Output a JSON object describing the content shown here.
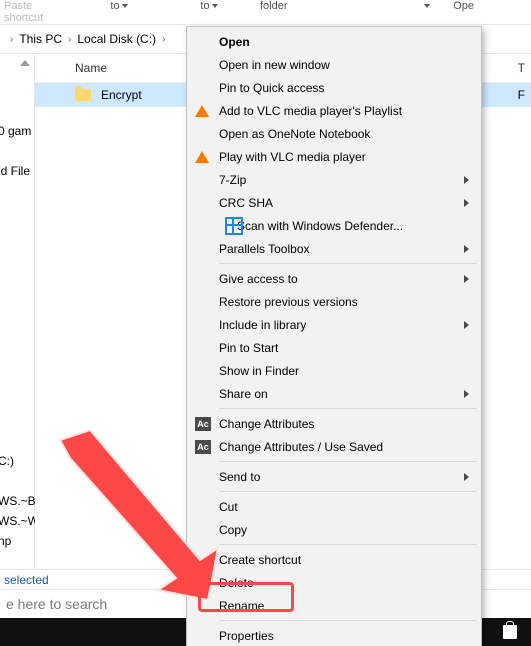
{
  "ribbon": {
    "paste": "Paste shortcut",
    "to1": "to",
    "to2": "to",
    "folder": "folder",
    "open": "Ope"
  },
  "breadcrumb": {
    "pc": "This PC",
    "disk": "Local Disk (C:)"
  },
  "list": {
    "header_name": "Name",
    "header_type": "T",
    "item0": "Encrypt",
    "item0_type_initial": "F"
  },
  "nav_ghosts": {
    "g1": "0 gam",
    "g2": "id File",
    "g3": "C:)",
    "g4": "WS.~B",
    "g5": "WS.~WS",
    "g6": "np"
  },
  "status": "selected",
  "search_placeholder": "e here to search",
  "ctx": {
    "open": "Open",
    "newwin": "Open in new window",
    "pinqa": "Pin to Quick access",
    "addvlc": "Add to VLC media player's Playlist",
    "onenote": "Open as OneNote Notebook",
    "playvlc": "Play with VLC media player",
    "zip": "7-Zip",
    "crc": "CRC SHA",
    "defender": "Scan with Windows Defender...",
    "parallels": "Parallels Toolbox",
    "giveaccess": "Give access to",
    "restore": "Restore previous versions",
    "include": "Include in library",
    "pinstart": "Pin to Start",
    "finder": "Show in Finder",
    "shareon": "Share on",
    "chattr": "Change Attributes",
    "chattr_saved": "Change Attributes / Use Saved",
    "sendto": "Send to",
    "cut": "Cut",
    "copy": "Copy",
    "shortcut": "Create shortcut",
    "delete": "Delete",
    "rename": "Rename",
    "properties": "Properties"
  }
}
